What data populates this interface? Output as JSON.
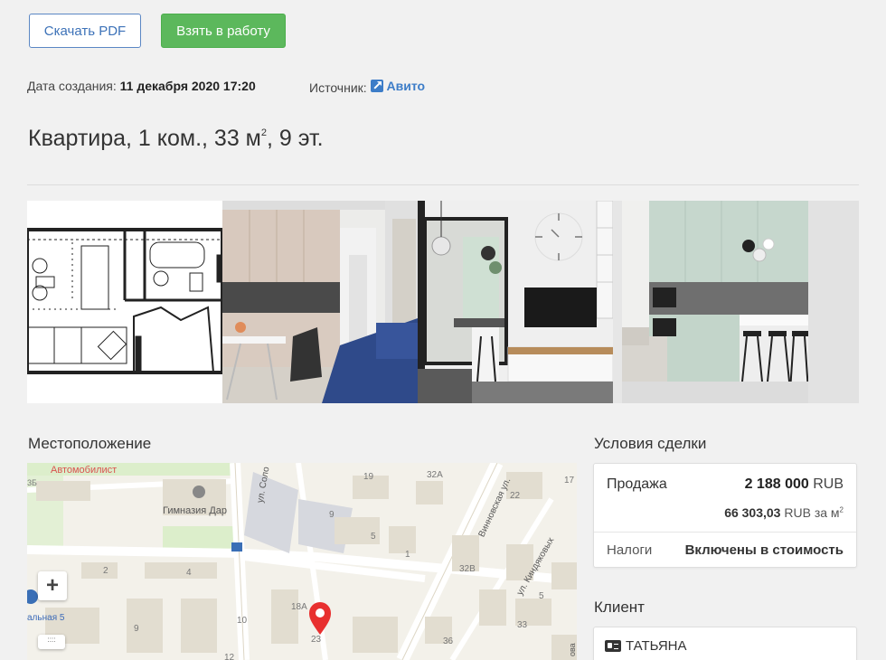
{
  "toolbar": {
    "pdf_label": "Скачать PDF",
    "work_label": "Взять в работу",
    "accent": "#5cb85c",
    "link_color": "#3d72b8"
  },
  "meta": {
    "created_label": "Дата создания:",
    "created_value": "11 декабря 2020 17:20",
    "source_label": "Источник:",
    "source_value": "Авито",
    "source_icon": "external-link-icon"
  },
  "listing": {
    "title": "Квартира, 1 ком., 33 м",
    "area_sup": "2",
    "title_tail": ", 9 эт."
  },
  "gallery": {
    "photos": [
      "floor-plan",
      "kitchen-living-room",
      "living-room-tv",
      "kitchen-bar"
    ]
  },
  "location": {
    "heading": "Местоположение",
    "map_labels": {
      "poi1": "Автомобилист",
      "poi2": "Гимназия Дар",
      "street1": "ул. Соло",
      "street2": "Винновская ул.",
      "street3": "ул. Киндяковых",
      "street4": "альная 5",
      "street5": "ова",
      "b1": "19",
      "b2": "32А",
      "b3": "17",
      "b4": "22",
      "b5": "3Б",
      "b6": "9",
      "b7": "5",
      "b8": "1",
      "b9": "2",
      "b10": "4",
      "b11": "32В",
      "b12": "5",
      "b13": "18А",
      "b14": "10",
      "b15": "9",
      "b16": "23",
      "b17": "36",
      "b18": "33",
      "b19": "12"
    },
    "zoom_in": "+",
    "ruler": "::::"
  },
  "deal": {
    "heading": "Условия сделки",
    "type": "Продажа",
    "price": "2 188 000",
    "currency": "RUB",
    "price_per_m": "66 303,03",
    "per_m_unit": "RUB за м",
    "per_m_sup": "2",
    "tax_label": "Налоги",
    "tax_value": "Включены в стоимость"
  },
  "client": {
    "heading": "Клиент",
    "name": "ТАТЬЯНА",
    "icon": "id-card-icon"
  }
}
